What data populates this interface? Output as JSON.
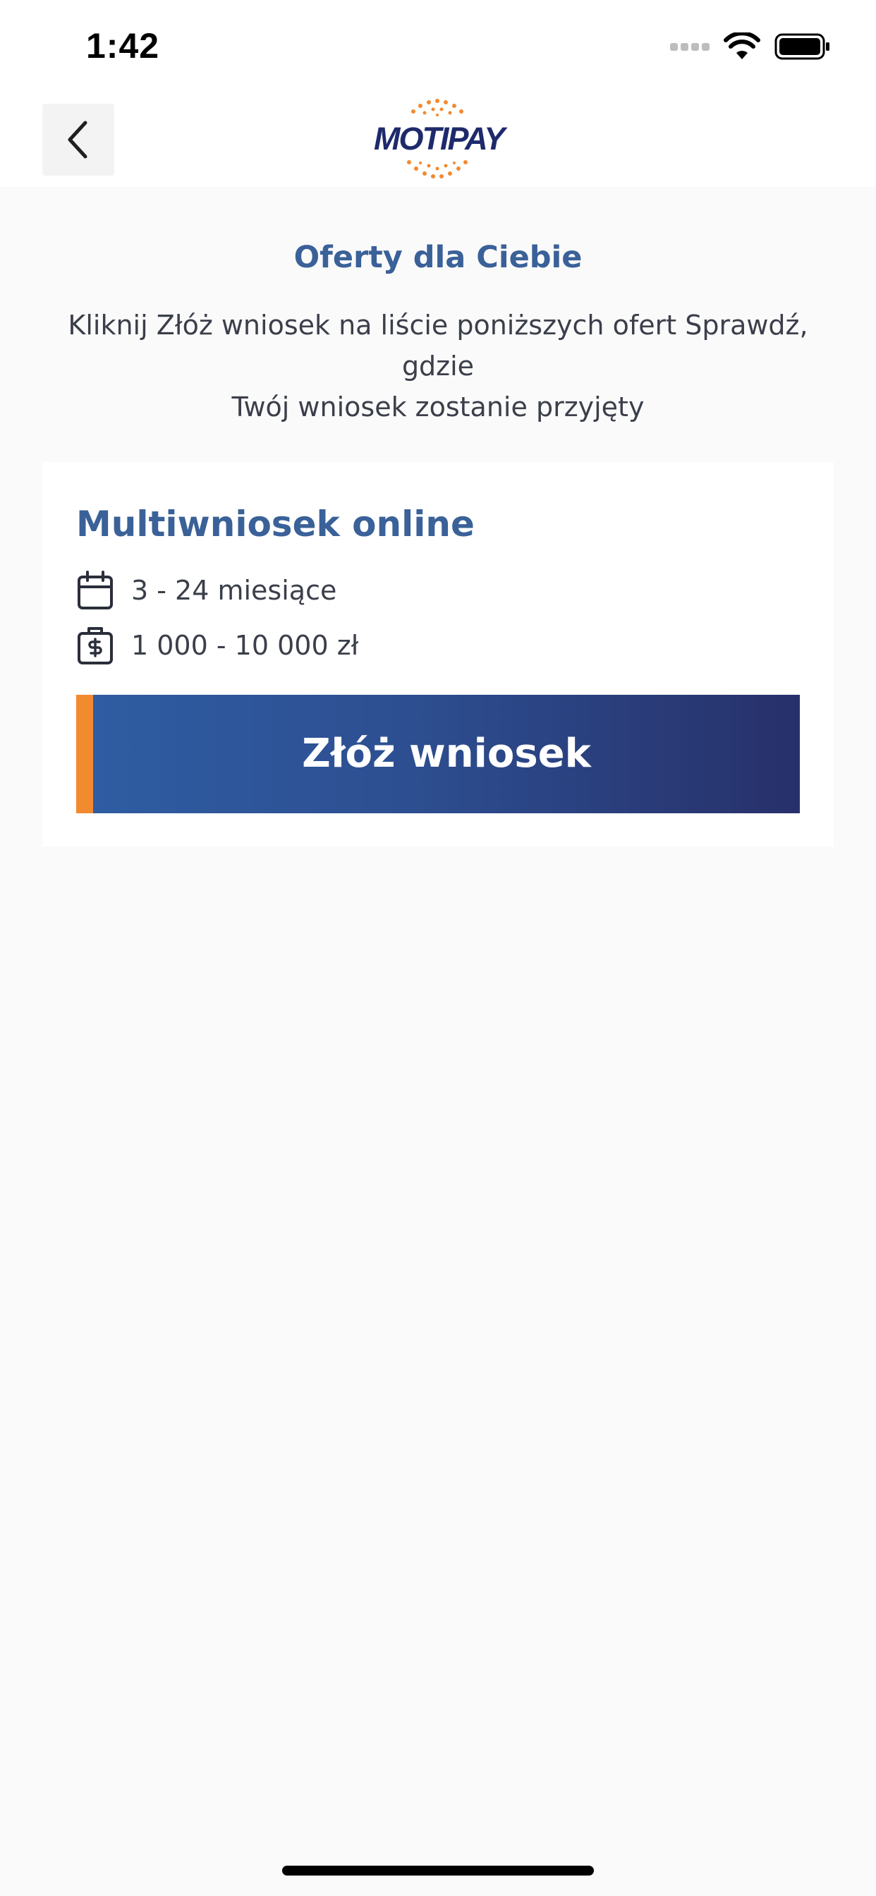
{
  "status_bar": {
    "time": "1:42"
  },
  "nav": {
    "back_icon": "chevron-left-icon",
    "logo_text": "MOTIPAY"
  },
  "page": {
    "title": "Oferty dla Ciebie",
    "subtitle_line1": "Kliknij Złóż wniosek na liście poniższych ofert Sprawdź, gdzie",
    "subtitle_line2": "Twój wniosek zostanie przyjęty"
  },
  "offer": {
    "title": "Multiwniosek online",
    "period_icon": "calendar-icon",
    "period": "3 - 24 miesiące",
    "amount_icon": "money-briefcase-icon",
    "amount": "1 000 - 10 000 zł",
    "apply_label": "Złóż wniosek"
  },
  "colors": {
    "brand_blue": "#3a6198",
    "button_gradient_start": "#2f5da3",
    "button_gradient_end": "#27306a",
    "accent_orange": "#f28a30",
    "logo_navy": "#1e2a6b"
  }
}
